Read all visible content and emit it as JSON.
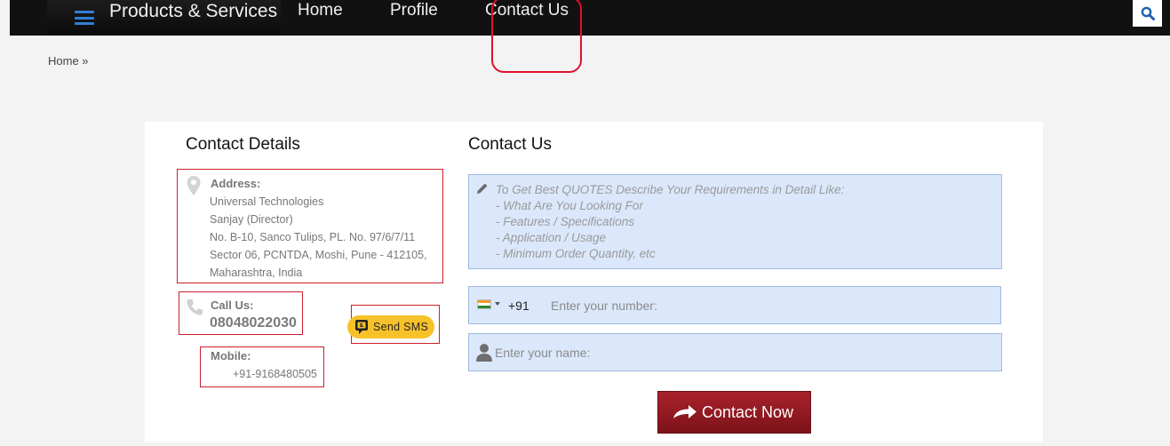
{
  "nav": {
    "products_label": "Products & Services",
    "home": "Home",
    "profile": "Profile",
    "contact": "Contact Us"
  },
  "breadcrumb": "Home »",
  "details": {
    "heading": "Contact Details",
    "address_label": "Address:",
    "address_lines": [
      "Universal Technologies",
      "Sanjay (Director)",
      "No. B-10, Sanco Tulips, PL. No. 97/6/7/11",
      "Sector 06, PCNTDA, Moshi, Pune - 412105,",
      "Maharashtra, India"
    ],
    "call_label": "Call Us:",
    "call_number": "08048022030",
    "sms_label": "Send SMS",
    "mobile_label": "Mobile:",
    "mobile_number": "+91-9168480505"
  },
  "form": {
    "heading": "Contact Us",
    "requirement_placeholder": [
      "To Get Best QUOTES Describe Your Requirements in Detail Like:",
      "- What Are You Looking For",
      "- Features / Specifications",
      "- Application / Usage",
      "- Minimum Order Quantity, etc"
    ],
    "dial_code": "+91",
    "phone_placeholder": "Enter your number:",
    "name_placeholder": "Enter your name:",
    "submit_label": "Contact Now"
  },
  "colors": {
    "nav_bg": "#111111",
    "accent_blue": "#2f7fd6",
    "field_bg": "#dbe8fb",
    "button_red": "#8e1a22",
    "sms_yellow": "#f7c12a",
    "annotation_red": "#e0102a"
  },
  "icons": {
    "menu": "hamburger-icon",
    "search": "search-icon",
    "address": "map-pin-icon",
    "call": "phone-icon",
    "sms": "sms-icon",
    "note": "pencil-icon",
    "country": "india-flag-icon",
    "name": "user-icon",
    "submit": "arrow-icon"
  }
}
